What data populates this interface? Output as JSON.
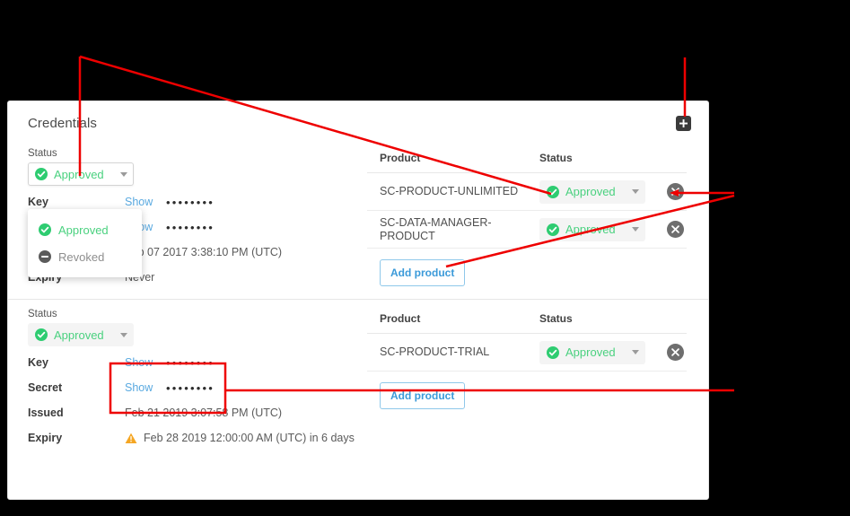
{
  "panel": {
    "title": "Credentials",
    "add_credential_icon": "plus-square-icon"
  },
  "labels": {
    "status": "Status",
    "key": "Key",
    "secret": "Secret",
    "issued": "Issued",
    "expiry": "Expiry",
    "product": "Product",
    "show": "Show",
    "add_product": "Add product",
    "masked_value": "••••••••"
  },
  "status_dropdown": {
    "selected": "Approved",
    "open": true,
    "options": [
      {
        "label": "Approved",
        "icon": "check-circle-icon",
        "color": "#4ad17f"
      },
      {
        "label": "Revoked",
        "icon": "ban-circle-icon",
        "color": "#8e8e8e"
      }
    ]
  },
  "credentials": [
    {
      "status": "Approved",
      "key_masked": "••••••••",
      "secret_masked": "••••••••",
      "issued": "Feb 07 2017 3:38:10 PM (UTC)",
      "expiry": "Never",
      "expiry_warning": false,
      "products": [
        {
          "name": "SC-PRODUCT-UNLIMITED",
          "status": "Approved"
        },
        {
          "name": "SC-DATA-MANAGER-PRODUCT",
          "status": "Approved"
        }
      ]
    },
    {
      "status": "Approved",
      "key_masked": "••••••••",
      "secret_masked": "••••••••",
      "issued": "Feb 21 2019 3:07:58 PM (UTC)",
      "expiry": "Feb 28 2019 12:00:00 AM (UTC) in 6 days",
      "expiry_warning": true,
      "products": [
        {
          "name": "SC-PRODUCT-TRIAL",
          "status": "Approved"
        }
      ]
    }
  ],
  "colors": {
    "approved_green": "#4ad17f",
    "link_blue": "#59a9e0",
    "button_blue": "#3b9ad9",
    "warning_orange": "#f5a623",
    "remove_gray": "#6e6e6e",
    "annotation_red": "#ee0000",
    "page_background": "#000000",
    "panel_background": "#ffffff"
  },
  "annotations": {
    "color": "#ee0000",
    "callouts": [
      "status-dropdown-callout",
      "product-status-callout",
      "remove-product-callout",
      "add-product-callout",
      "key-secret-callout"
    ]
  }
}
